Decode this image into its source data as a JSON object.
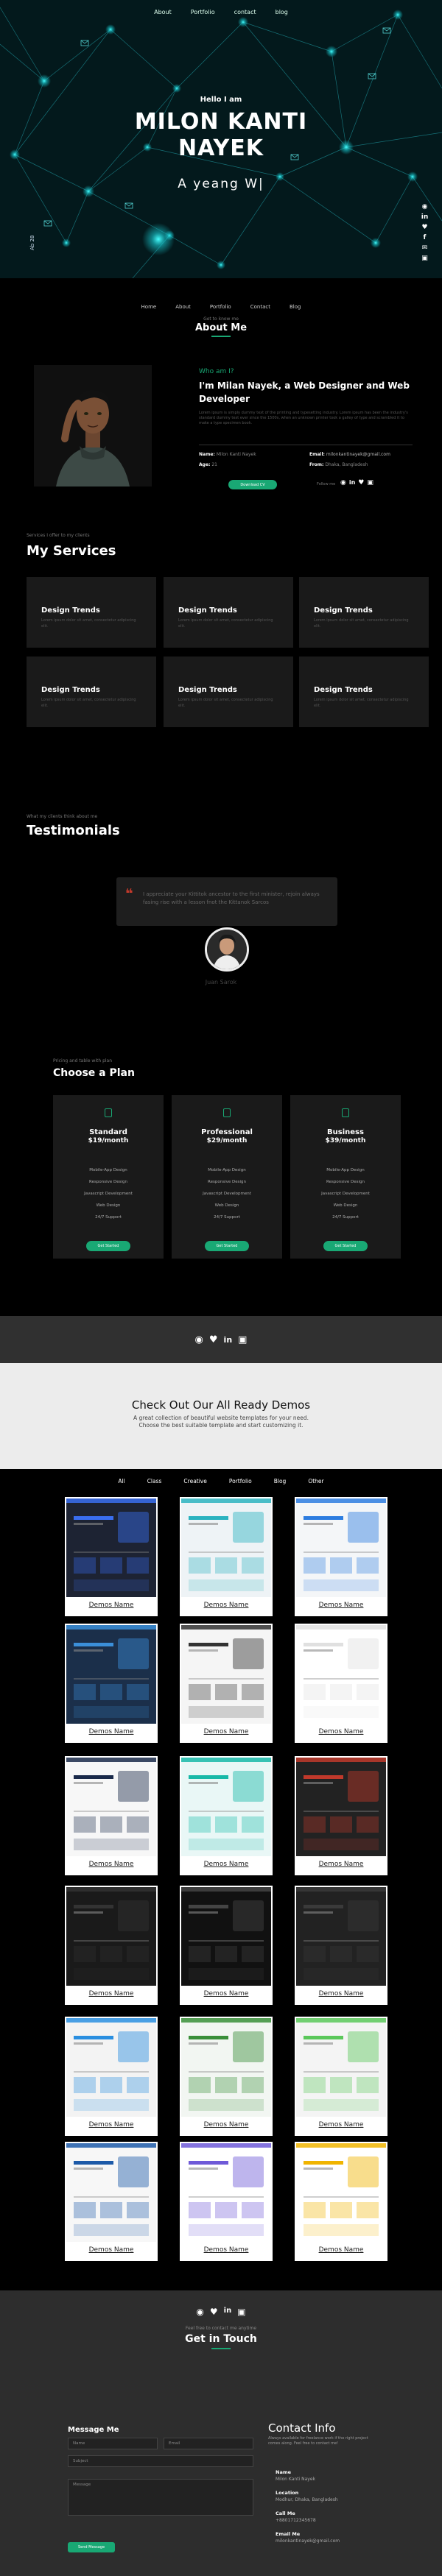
{
  "hero": {
    "nav": [
      "About",
      "Portfolio",
      "contact",
      "blog"
    ],
    "greeting": "Hello I am",
    "name_line1": "MILON KANTI",
    "name_line2": "NAYEK",
    "typed": "A yeang W|",
    "side_label": "Ab 28",
    "social_icons": [
      "github-icon",
      "linkedin-icon",
      "twitter-icon",
      "facebook-icon",
      "envelope-icon",
      "instagram-icon"
    ]
  },
  "about": {
    "nav": [
      "Home",
      "About",
      "Portfolio",
      "Contact",
      "Blog"
    ],
    "kicker": "Get to know me",
    "title": "About Me",
    "who": "Who am I?",
    "headline": "I'm Milan Nayek, a Web Designer and Web Developer",
    "bio": "Lorem ipsum is simply dummy text of the printing and typesetting industry. Lorem ipsum has been the industry's standard dummy text ever since the 1500s, when an unknown printer took a galley of type and scrambled it to make a type specimen book.",
    "name_label": "Name:",
    "name_value": "Milon Kanti Nayek",
    "age_label": "Age:",
    "age_value": "21",
    "email_label": "Email:",
    "email_value": "milonkantinayek@gmail.com",
    "from_label": "From:",
    "from_value": "Dhaka, Bangladesh",
    "cv_button": "Download CV",
    "follow_label": "Follow me",
    "follow_icons": [
      "github-icon",
      "linkedin-icon",
      "twitter-icon",
      "instagram-icon"
    ]
  },
  "services": {
    "kicker": "Services I offer to my clients",
    "title": "My Services",
    "items": [
      {
        "title": "Design Trends",
        "desc": "Lorem ipsum dolor sit amet, consectetur adipiscing elit."
      },
      {
        "title": "Design Trends",
        "desc": "Lorem ipsum dolor sit amet, consectetur adipiscing elit."
      },
      {
        "title": "Design Trends",
        "desc": "Lorem ipsum dolor sit amet, consectetur adipiscing elit."
      },
      {
        "title": "Design Trends",
        "desc": "Lorem ipsum dolor sit amet, consectetur adipiscing elit."
      },
      {
        "title": "Design Trends",
        "desc": "Lorem ipsum dolor sit amet, consectetur adipiscing elit."
      },
      {
        "title": "Design Trends",
        "desc": "Lorem ipsum dolor sit amet, consectetur adipiscing elit."
      }
    ]
  },
  "testimonials": {
    "kicker": "What my clients think about me",
    "title": "Testimonials",
    "quote": "I appreciate your Kittitok ancestor to the first minister, rejoin always fasing rise with a lesson fnot the Kittanok Sarcos",
    "author": "Juan Sarok"
  },
  "pricing": {
    "kicker": "Pricing and table with plan",
    "title": "Choose a Plan",
    "plans": [
      {
        "name": "Standard",
        "price": "$19/month",
        "features": [
          "Mobile-App Design",
          "Responsive Design",
          "Javascript Development",
          "Web Design",
          "24/7 Support"
        ],
        "button": "Get Started"
      },
      {
        "name": "Professional",
        "price": "$29/month",
        "features": [
          "Mobile-App Design",
          "Responsive Design",
          "Javascript Development",
          "Web Design",
          "24/7 Support"
        ],
        "button": "Get Started"
      },
      {
        "name": "Business",
        "price": "$39/month",
        "features": [
          "Mobile-App Design",
          "Responsive Design",
          "Javascript Development",
          "Web Design",
          "24/7 Support"
        ],
        "button": "Get Started"
      }
    ]
  },
  "socialbar": {
    "icons": [
      "github-icon",
      "twitter-icon",
      "linkedin-icon",
      "instagram-icon"
    ]
  },
  "demos_head": {
    "title": "Check Out Our All Ready Demos",
    "line1": "A great collection of beautiful website templates for your need.",
    "line2": "Choose the best suitable template and start customizing it."
  },
  "demos": {
    "filters": [
      "All",
      "Class",
      "Creative",
      "Portfolio",
      "Blog",
      "Other"
    ],
    "label": "Demos Name",
    "count": 18
  },
  "contact": {
    "social_icons": [
      "github-icon",
      "twitter-icon",
      "linkedin-icon",
      "instagram-icon"
    ],
    "kicker": "Feel free to contact me anytime",
    "title": "Get in Touch",
    "form_title": "Message Me",
    "name_placeholder": "Name",
    "email_placeholder": "Email",
    "subject_placeholder": "Subject",
    "message_placeholder": "Message",
    "send": "Send Message",
    "info_title": "Contact Info",
    "info_text": "Always available for freelance work if the right project comes along. Feel free to contact me!",
    "info": [
      {
        "label": "Name",
        "value": "Milon Kanti Nayek"
      },
      {
        "label": "Location",
        "value": "Modhur, Dhaka, Bangladesh"
      },
      {
        "label": "Call Me",
        "value": "+8801712345678"
      },
      {
        "label": "Email Me",
        "value": "milonkantinayek@gmail.com"
      }
    ]
  },
  "colors": {
    "accent": "#19a874",
    "hero_bg": "#03191c",
    "card_bg": "#1a1a1a",
    "bar_bg": "#303030"
  }
}
